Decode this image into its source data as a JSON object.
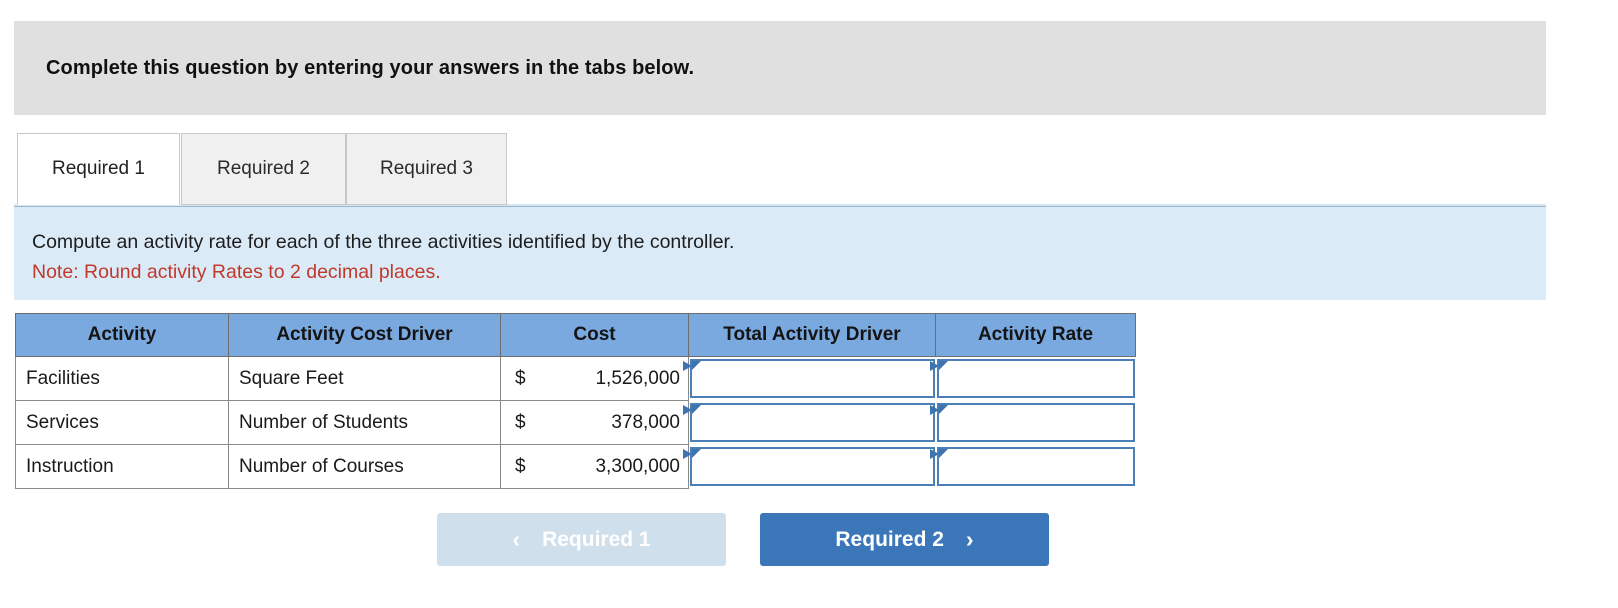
{
  "banner": {
    "text": "Complete this question by entering your answers in the tabs below."
  },
  "tabs": [
    {
      "label": "Required 1",
      "active": true
    },
    {
      "label": "Required 2",
      "active": false
    },
    {
      "label": "Required 3",
      "active": false
    }
  ],
  "instructions": {
    "line1": "Compute an activity rate for each of the three activities identified by the controller.",
    "note": "Note: Round activity Rates to 2 decimal places."
  },
  "table": {
    "headers": [
      "Activity",
      "Activity Cost Driver",
      "Cost",
      "Total Activity Driver",
      "Activity Rate"
    ],
    "rows": [
      {
        "activity": "Facilities",
        "cost_driver": "Square Feet",
        "cost_symbol": "$",
        "cost_value": "1,526,000",
        "total_activity_driver": "",
        "activity_rate": ""
      },
      {
        "activity": "Services",
        "cost_driver": "Number of Students",
        "cost_symbol": "$",
        "cost_value": "378,000",
        "total_activity_driver": "",
        "activity_rate": ""
      },
      {
        "activity": "Instruction",
        "cost_driver": "Number of Courses",
        "cost_symbol": "$",
        "cost_value": "3,300,000",
        "total_activity_driver": "",
        "activity_rate": ""
      }
    ]
  },
  "nav": {
    "prev_label": "Required 1",
    "prev_chevron": "‹",
    "next_label": "Required 2",
    "next_chevron": "›"
  },
  "colors": {
    "banner_bg": "#e0e0e0",
    "instruction_bg": "#dbeaf7",
    "note_text": "#c0392b",
    "table_header_bg": "#7aa9e0",
    "input_border": "#4a7fb8",
    "next_button_bg": "#3b77b8",
    "prev_button_bg": "#cfdfec"
  }
}
